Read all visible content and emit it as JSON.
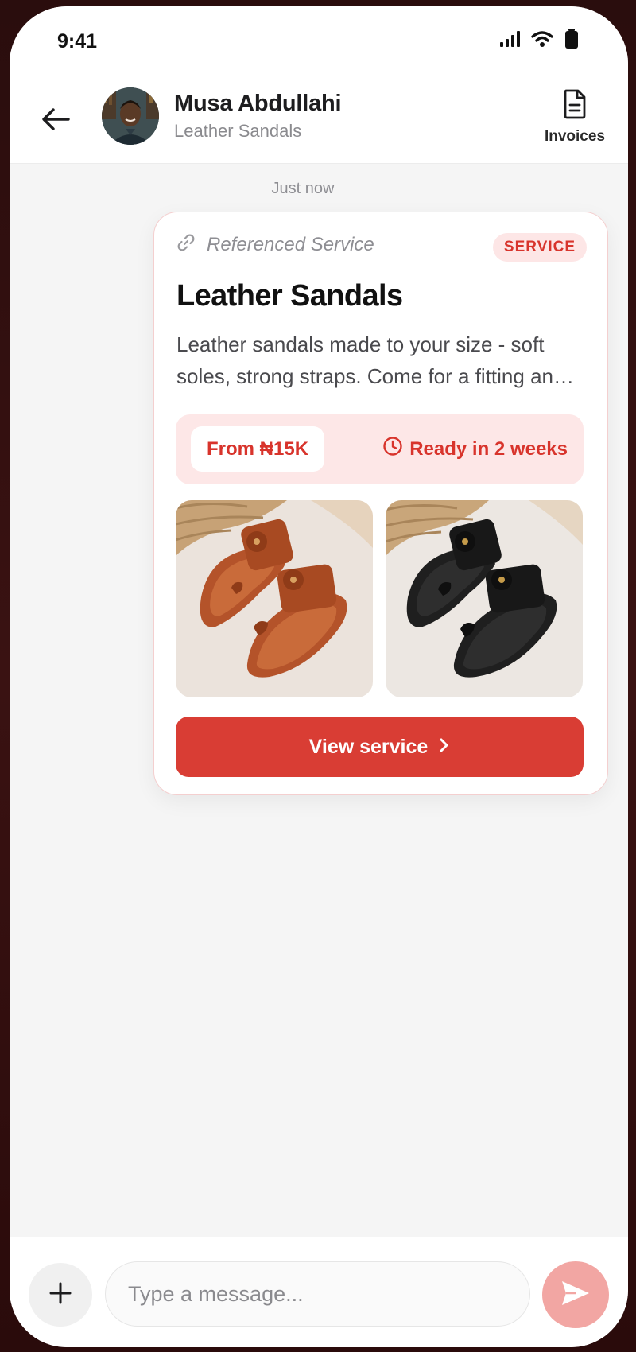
{
  "status_bar": {
    "time": "9:41",
    "icons": [
      "cellular-signal-icon",
      "wifi-icon",
      "battery-icon"
    ]
  },
  "header": {
    "back_icon": "arrow-left-icon",
    "contact_name": "Musa Abdullahi",
    "contact_subtitle": "Leather Sandals",
    "invoices_label": "Invoices",
    "invoices_icon": "document-icon"
  },
  "chat": {
    "timestamp": "Just now",
    "service_card": {
      "reference_label": "Referenced Service",
      "reference_icon": "link-icon",
      "badge": "SERVICE",
      "title": "Leather Sandals",
      "description": "Leather sandals made to your size - soft soles, strong straps. Come for a fitting and choose your colour.",
      "price": "From ₦15K",
      "ready_time": "Ready in 2 weeks",
      "ready_icon": "clock-icon",
      "images": [
        "brown-leather-sandals",
        "black-leather-sandals"
      ],
      "cta_label": "View service",
      "cta_icon": "chevron-right-icon"
    }
  },
  "composer": {
    "add_icon": "plus-icon",
    "placeholder": "Type a message...",
    "send_icon": "send-icon"
  },
  "colors": {
    "accent": "#d93d34",
    "accent_soft": "#fde7e7",
    "send_disabled": "#f2a6a3",
    "chat_background": "#f5f5f5"
  }
}
